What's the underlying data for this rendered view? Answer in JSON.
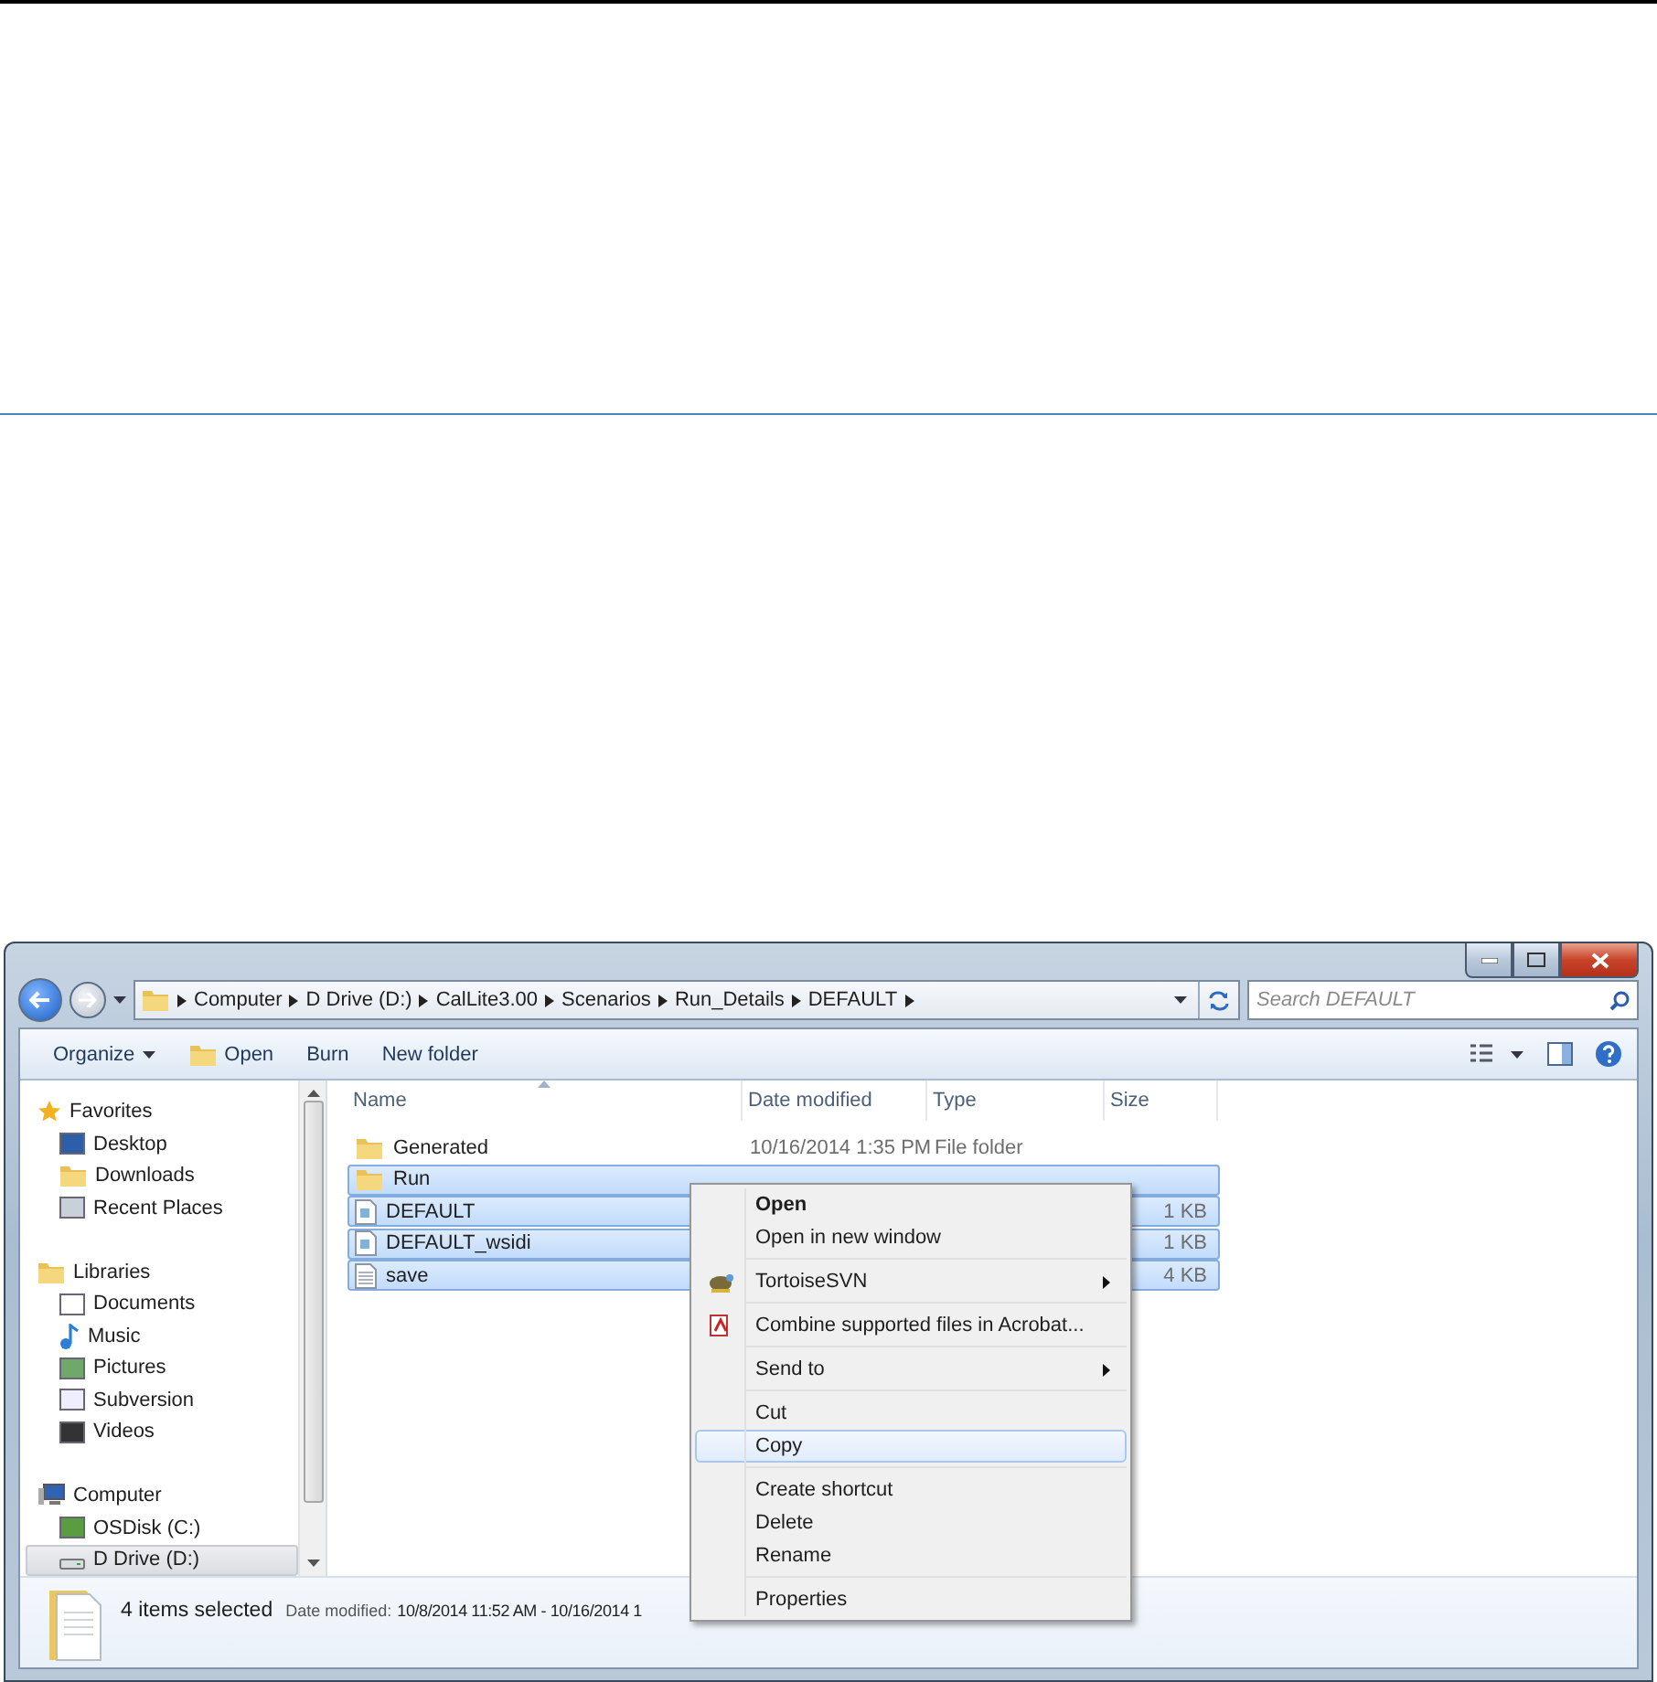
{
  "address": {
    "crumbs": [
      "Computer",
      "D Drive (D:)",
      "CalLite3.00",
      "Scenarios",
      "Run_Details",
      "DEFAULT"
    ]
  },
  "search": {
    "placeholder": "Search DEFAULT"
  },
  "toolbar": [
    {
      "label": "Organize",
      "dropdown": true
    },
    {
      "label": "Open",
      "dropdown": false
    },
    {
      "label": "Burn",
      "dropdown": false
    },
    {
      "label": "New folder",
      "dropdown": false
    }
  ],
  "nav": [
    {
      "label": "Favorites",
      "selected": false,
      "children": [
        {
          "label": "Desktop",
          "selected": false
        },
        {
          "label": "Downloads",
          "selected": false
        },
        {
          "label": "Recent Places",
          "selected": false
        }
      ]
    },
    {
      "label": "Libraries",
      "selected": false,
      "children": [
        {
          "label": "Documents",
          "selected": false
        },
        {
          "label": "Music",
          "selected": false
        },
        {
          "label": "Pictures",
          "selected": false
        },
        {
          "label": "Subversion",
          "selected": false
        },
        {
          "label": "Videos",
          "selected": false
        }
      ]
    },
    {
      "label": "Computer",
      "selected": false,
      "children": [
        {
          "label": "OSDisk (C:)",
          "selected": false
        },
        {
          "label": "D Drive (D:)",
          "selected": true
        }
      ]
    }
  ],
  "columns": [
    "Name",
    "Date modified",
    "Type",
    "Size"
  ],
  "files": [
    {
      "name": "Generated",
      "date": "10/16/2014 1:35 PM",
      "type": "File folder",
      "kind": "folder",
      "selected": false
    },
    {
      "name": "Run",
      "kind": "folder",
      "selected": true
    },
    {
      "name": "DEFAULT",
      "size": "1 KB",
      "kind": "file",
      "selected": true
    },
    {
      "name": "DEFAULT_wsidi",
      "size": "1 KB",
      "kind": "file",
      "selected": true
    },
    {
      "name": "save",
      "size": "4 KB",
      "kind": "text",
      "selected": true
    }
  ],
  "status": {
    "summary": "4 items selected",
    "label": "Date modified:",
    "value": "10/8/2014 11:52 AM - 10/16/2014 1"
  },
  "menu": {
    "groups": [
      [
        {
          "label": "Open",
          "bold": true,
          "submenu": false,
          "kind": "plain",
          "selected": false
        },
        {
          "label": "Open in new window",
          "bold": false,
          "submenu": false,
          "kind": "plain",
          "selected": false
        }
      ],
      [
        {
          "label": "TortoiseSVN",
          "bold": false,
          "submenu": true,
          "kind": "svn",
          "selected": false
        }
      ],
      [
        {
          "label": "Combine supported files in Acrobat...",
          "bold": false,
          "submenu": false,
          "kind": "acrobat",
          "selected": false
        }
      ],
      [
        {
          "label": "Send to",
          "bold": false,
          "submenu": true,
          "kind": "plain",
          "selected": false
        }
      ],
      [
        {
          "label": "Cut",
          "bold": false,
          "submenu": false,
          "kind": "plain",
          "selected": false
        },
        {
          "label": "Copy",
          "bold": false,
          "submenu": false,
          "kind": "plain",
          "selected": true
        }
      ],
      [
        {
          "label": "Create shortcut",
          "bold": false,
          "submenu": false,
          "kind": "plain",
          "selected": false
        },
        {
          "label": "Delete",
          "bold": false,
          "submenu": false,
          "kind": "plain",
          "selected": false
        },
        {
          "label": "Rename",
          "bold": false,
          "submenu": false,
          "kind": "plain",
          "selected": false
        }
      ],
      [
        {
          "label": "Properties",
          "bold": false,
          "submenu": false,
          "kind": "plain",
          "selected": false
        }
      ]
    ]
  }
}
